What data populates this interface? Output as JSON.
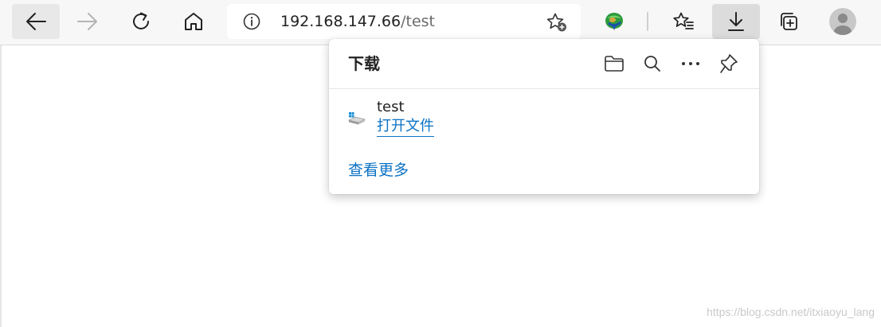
{
  "address_bar": {
    "host": "192.168.147.66",
    "path": "/test"
  },
  "downloads_panel": {
    "title": "下载",
    "items": [
      {
        "file_name": "test",
        "action_label": "打开文件"
      }
    ],
    "see_more_label": "查看更多"
  },
  "watermark": "https://blog.csdn.net/itxiaoyu_lang",
  "icons": {
    "back": "arrow-left-icon",
    "forward": "arrow-right-icon",
    "refresh": "refresh-icon",
    "home": "home-icon",
    "info": "info-icon",
    "add_favorite": "star-add-icon",
    "idm": "idm-extension-icon",
    "favorites": "favorites-list-icon",
    "downloads": "download-icon",
    "collections": "collections-icon",
    "profile": "avatar-icon",
    "open_folder": "folder-icon",
    "search": "search-icon",
    "more": "more-icon",
    "pin": "pin-icon"
  },
  "colors": {
    "link": "#0b72c4",
    "toolbar_bg": "#f7f7f7",
    "active_button_bg": "#dcdcdc"
  }
}
